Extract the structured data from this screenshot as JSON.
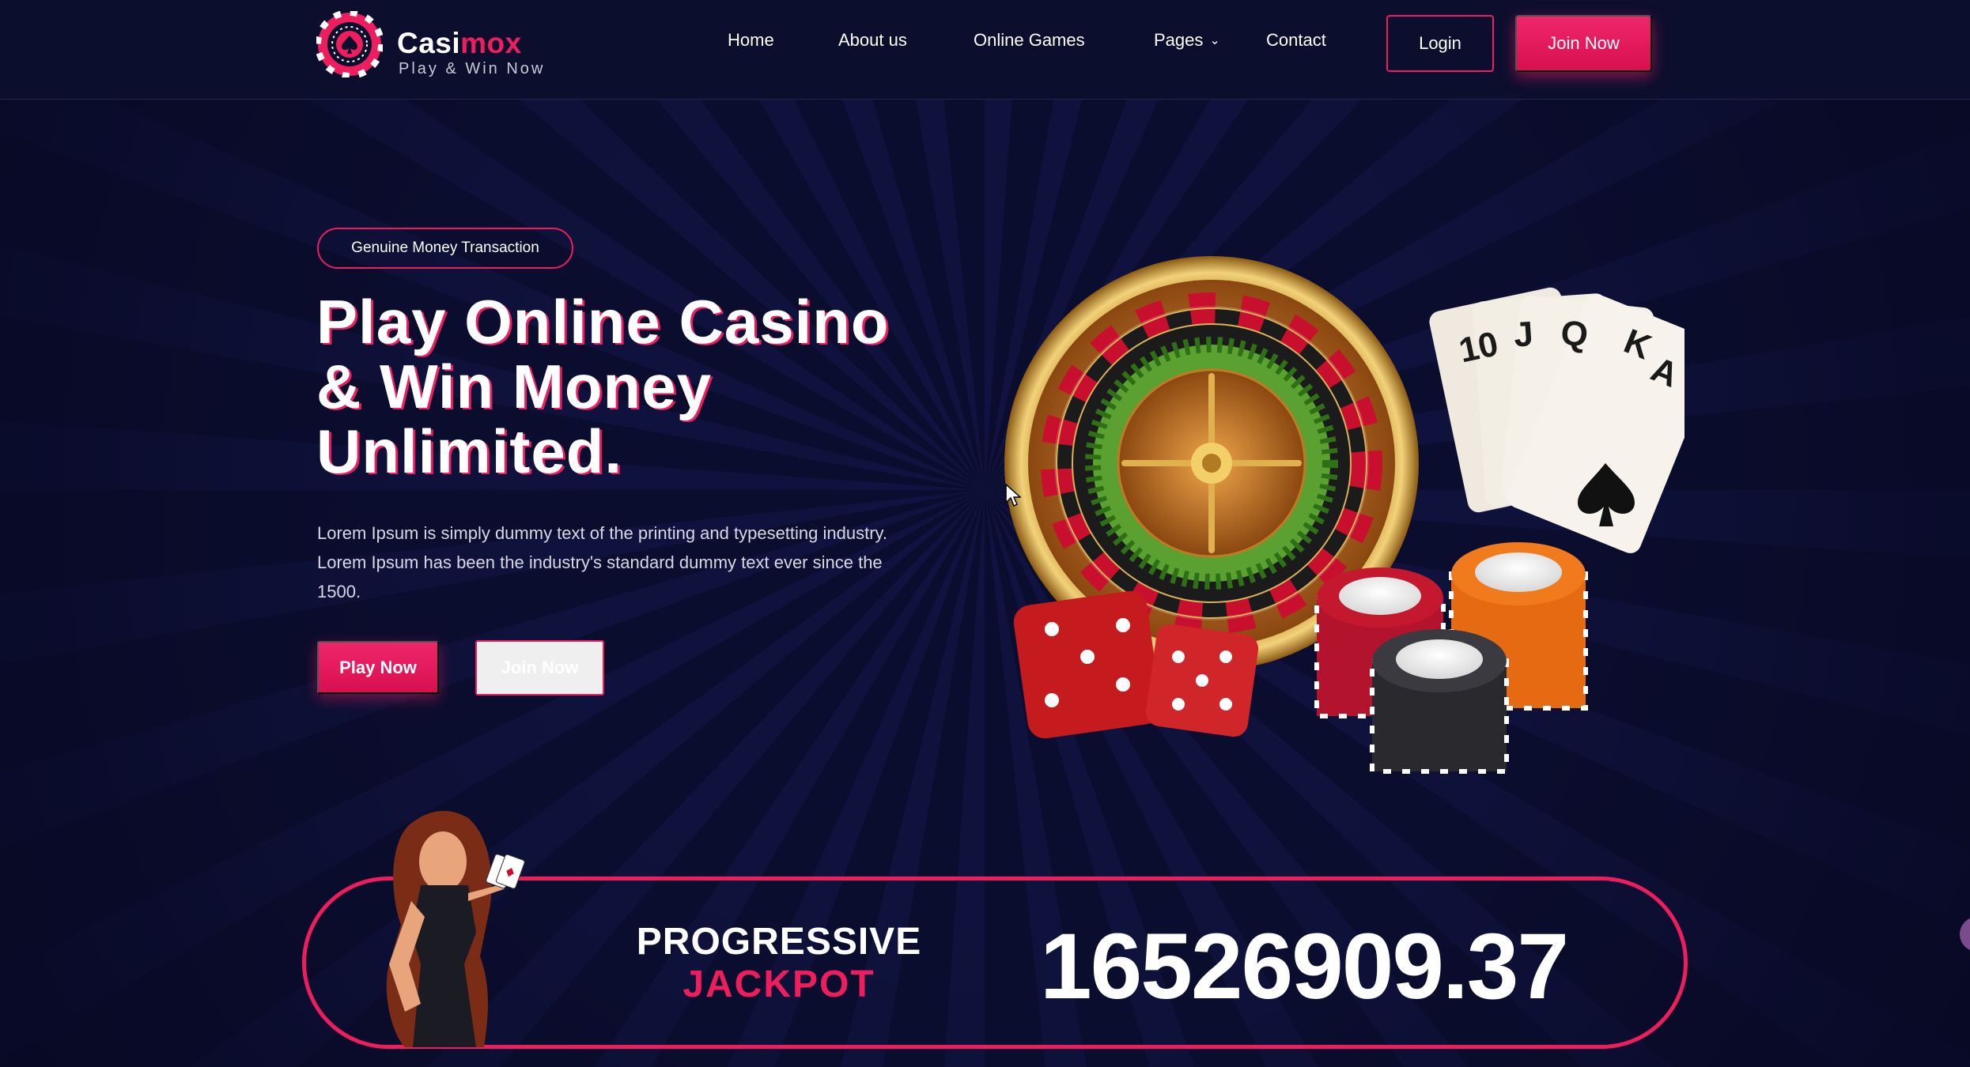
{
  "brand": {
    "name_part1": "Casi",
    "name_part2": "mox",
    "tagline": "Play & Win Now",
    "accent_color": "#ee1d5e",
    "background_color": "#0c0e30"
  },
  "nav": {
    "items": [
      {
        "label": "Home"
      },
      {
        "label": "About us"
      },
      {
        "label": "Online Games"
      },
      {
        "label": "Pages",
        "has_dropdown": true
      },
      {
        "label": "Contact"
      }
    ],
    "login_label": "Login",
    "join_label": "Join Now"
  },
  "hero": {
    "badge": "Genuine Money Transaction",
    "title_line1": "Play Online Casino",
    "title_line2": "& Win Money",
    "title_line3": "Unlimited.",
    "description": "Lorem Ipsum is simply dummy text of the printing and typesetting industry. Lorem Ipsum has been the industry's standard dummy text ever since the 1500.",
    "play_label": "Play Now",
    "join_label": "Join Now"
  },
  "jackpot": {
    "line1": "PROGRESSIVE",
    "line2": "JACKPOT",
    "amount": "16526909.37"
  },
  "icons": {
    "logo": "poker-chip-spade-icon",
    "dropdown": "chevron-down-icon",
    "cursor": "mouse-pointer-icon"
  }
}
